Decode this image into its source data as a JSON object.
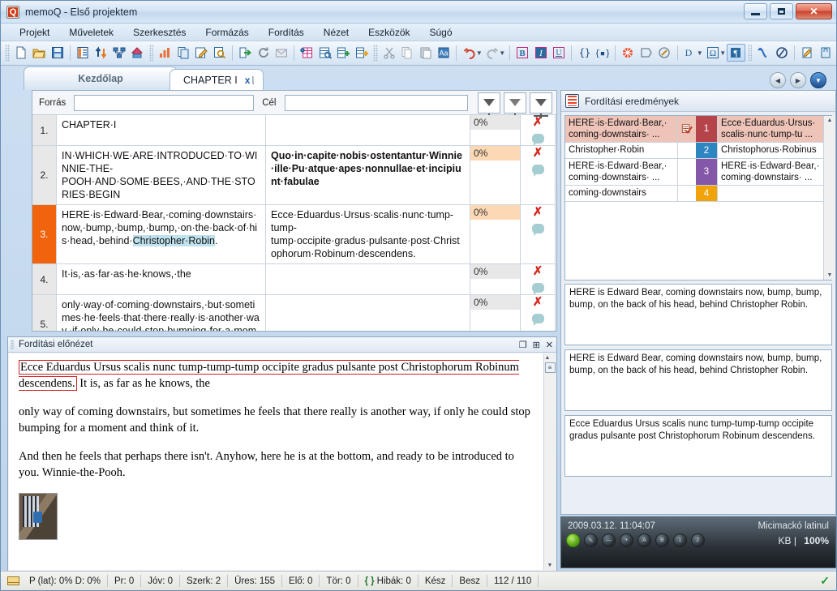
{
  "window": {
    "title": "memoQ - Első projektem",
    "app_icon": "memoq-logo-icon",
    "minimize_label": "Minimize",
    "maximize_label": "Maximize",
    "close_label": "✕"
  },
  "menu": {
    "items": [
      {
        "label": "Projekt",
        "name": "menu-projekt"
      },
      {
        "label": "Műveletek",
        "name": "menu-muveletek"
      },
      {
        "label": "Szerkesztés",
        "name": "menu-szerkesztes"
      },
      {
        "label": "Formázás",
        "name": "menu-formazas"
      },
      {
        "label": "Fordítás",
        "name": "menu-forditas"
      },
      {
        "label": "Nézet",
        "name": "menu-nezet"
      },
      {
        "label": "Eszközök",
        "name": "menu-eszkozok"
      },
      {
        "label": "Súgó",
        "name": "menu-sugo"
      }
    ]
  },
  "toolbar": {
    "groups": [
      [
        "new-document-icon",
        "open-folder-icon",
        "save-icon"
      ],
      [
        "project-icon",
        "import-export-icon",
        "network-icon",
        "deliver-icon"
      ],
      [
        "statistics-icon",
        "copy-document-icon",
        "edit-document-icon",
        "preview-document-icon"
      ],
      [
        "export-icon",
        "refresh-icon",
        "mail-icon"
      ],
      [
        "term-base-icon",
        "concordance-icon",
        "add-term-icon",
        "add-term-plus-icon"
      ],
      [
        "cut-icon",
        "copy-icon",
        "paste-icon",
        "format-painter-icon"
      ],
      [
        "undo-icon",
        "redo-icon"
      ],
      [
        "bold-icon",
        "italic-icon",
        "underline-icon"
      ],
      [
        "tag-insert-icon",
        "tag-pair-icon"
      ],
      [
        "spellcheck-icon",
        "comment-icon",
        "quality-icon"
      ],
      [
        "dropcap-icon",
        "symbol-icon",
        "pilcrow-icon"
      ],
      [
        "join-icon",
        "split-icon"
      ],
      [
        "edit-note-icon",
        "lock-icon"
      ]
    ],
    "active_button": "pilcrow-icon"
  },
  "tabs": {
    "home": {
      "label": "Kezdőlap",
      "name": "tab-kezdolap"
    },
    "document": {
      "label": "CHAPTER I",
      "close": "x",
      "name": "tab-chapter-i"
    },
    "nav_prev": "◀",
    "nav_next": "▶",
    "nav_menu": "▼"
  },
  "filter_bar": {
    "source_label": "Forrás",
    "source_value": "",
    "source_placeholder": "",
    "target_label": "Cél",
    "target_value": "",
    "target_placeholder": "",
    "buttons": [
      "filter-funnel-icon",
      "filter-clear-icon",
      "sort-icon"
    ]
  },
  "grid": {
    "rows": [
      {
        "num": "1.",
        "source": "CHAPTER·I",
        "target": "",
        "target_bold": false,
        "pct": "0%",
        "selected": false,
        "warn": false,
        "status_icon": "error-x-icon",
        "comment_icon": "comment-bubble-icon"
      },
      {
        "num": "2.",
        "source": "IN·WHICH·WE·ARE·INTRODUCED·TO·WINNIE-THE-POOH·AND·SOME·BEES,·AND·THE·STORIES·BEGIN",
        "target": "Quo·in·capite·nobis·ostentantur·Winnie·ille·Pu·atque·apes·nonnullae·et·incipiunt·fabulae",
        "target_bold": true,
        "pct": "0%",
        "selected": false,
        "warn": true,
        "status_icon": "error-x-icon",
        "comment_icon": "comment-bubble-icon"
      },
      {
        "num": "3.",
        "source_pre": "HERE·is·Edward·Bear,·coming·downstairs·now,·bump,·bump,·bump,·on·the·back·of·his·head,·behind·",
        "source_hl": "Christopher·Robin",
        "source_post": ".",
        "source": "HERE·is·Edward·Bear,·coming·downstairs·now,·bump,·bump,·bump,·on·the·back·of·his·head,·behind·Christopher·Robin.",
        "target": "Ecce·Eduardus·Ursus·scalis·nunc·tump-tump-tump·occipite·gradus·pulsante·post·Christophorum·Robinum·descendens.",
        "target_bold": false,
        "pct": "0%",
        "selected": true,
        "warn": true,
        "status_icon": "error-x-icon",
        "comment_icon": "comment-bubble-icon"
      },
      {
        "num": "4.",
        "source": "It·is,·as·far·as·he·knows,·the",
        "target": "",
        "target_bold": false,
        "pct": "0%",
        "selected": false,
        "warn": false,
        "status_icon": "error-x-icon",
        "comment_icon": "comment-bubble-icon"
      },
      {
        "num": "5.",
        "source": "only·way·of·coming·downstairs,·but·sometimes·he·feels·that·there·really·is·another·way,·if·only·he·could·stop·bumping·for·a·moment·and·think·of·it.",
        "target": "",
        "target_bold": false,
        "pct": "0%",
        "selected": false,
        "warn": false,
        "status_icon": "error-x-icon",
        "comment_icon": "comment-bubble-icon"
      }
    ]
  },
  "results_panel": {
    "title": "Fordítási eredmények",
    "icon": "translation-results-icon",
    "rows": [
      {
        "source": "HERE·is·Edward·Bear,· coming·downstairs· ...",
        "target": "Ecce·Eduardus·Ursus· scalis·nunc·tump-tu ...",
        "rank": "1",
        "rank_color": "#b5444a",
        "flag_icon": "edited-match-icon",
        "highlighted": true
      },
      {
        "source": "Christopher·Robin",
        "target": "Christophorus·Robinus",
        "rank": "2",
        "rank_color": "#2e86c1",
        "flag_icon": "",
        "highlighted": false
      },
      {
        "source": "HERE·is·Edward·Bear,· coming·downstairs· ...",
        "target": "HERE·is·Edward·Bear,· coming·downstairs· ...",
        "rank": "3",
        "rank_color": "#8557a8",
        "flag_icon": "",
        "highlighted": false
      },
      {
        "source": "coming·downstairs",
        "target": "",
        "rank": "4",
        "rank_color": "#f0a30a",
        "flag_icon": "",
        "highlighted": false
      }
    ],
    "detail_boxes": [
      "HERE is Edward Bear, coming downstairs now, bump, bump, bump, on the back of his head, behind Christopher Robin.",
      "HERE is Edward Bear, coming downstairs now, bump, bump, bump, on the back of his head, behind Christopher Robin.",
      "Ecce Eduardus Ursus scalis nunc tump-tump-tump occipite gradus pulsante post Christophorum Robinum descendens."
    ],
    "meta": {
      "timestamp": "2009.03.12. 11:04:07",
      "source_name": "Micimackó latinul",
      "kb_label": "KB",
      "separator": "|",
      "match_pct": "100%",
      "orbs": [
        "status-active-icon",
        "status-pen-icon",
        "status-minus-icon",
        "status-dot-icon",
        "status-a-icon",
        "status-b-icon",
        "status-1-icon",
        "status-2-icon"
      ]
    }
  },
  "preview_panel": {
    "title": "Fordítási előnézet",
    "buttons": [
      "restore-icon",
      "pin-icon",
      "close-icon"
    ],
    "paragraph1_hl": "Ecce Eduardus Ursus scalis nunc tump-tump-tump occipite gradus pulsante post Christophorum Robinum descendens.",
    "paragraph1_rest": " It is, as far as he knows, the",
    "paragraph2": "only way of coming downstairs, but sometimes he feels that there really is another way, if only he could stop bumping for a moment and think of it.",
    "paragraph3": "And then he feels that perhaps there isn't. Anyhow, here he is at the bottom, and ready to be introduced to you. Winnie-the-Pooh.",
    "image_alt": "pooh-on-stairs-thumbnail"
  },
  "statusbar": {
    "mail_icon": "mail-status-icon",
    "cells": [
      "P (lat): 0%  D: 0%",
      "Pr: 0",
      "Jóv: 0",
      "Szerk: 2",
      "Üres: 155",
      "Elő: 0",
      "Tör: 0"
    ],
    "errors_braces": "{ }",
    "errors_label": "Hibák: 0",
    "ready": "Kész",
    "insert_mode": "Besz",
    "counter": "112 / 110",
    "check_icon": "green-check-icon"
  },
  "colors": {
    "selected_row": "#f1630d",
    "warn_cell": "#fcd9b4",
    "error_x": "#d42a1f",
    "highlight_term": "#bfe2ee"
  }
}
